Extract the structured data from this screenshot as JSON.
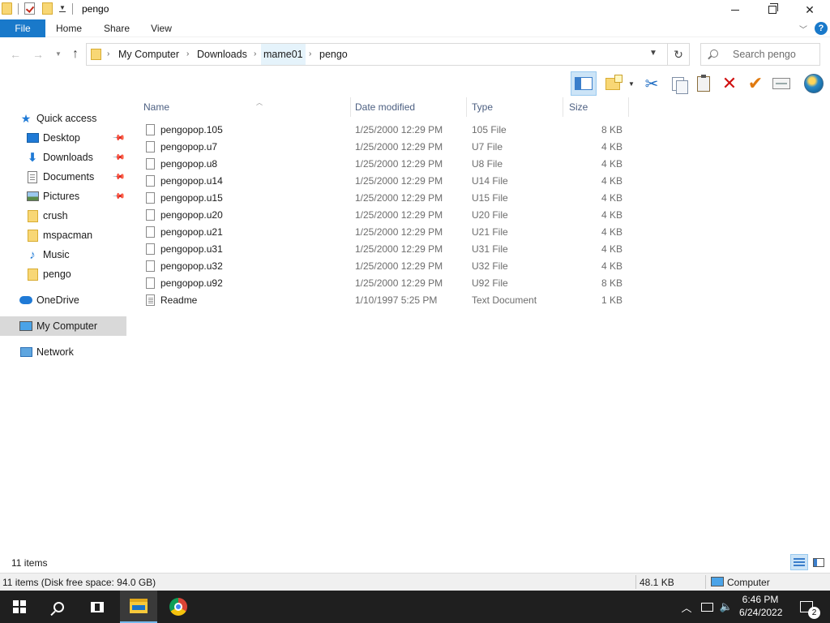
{
  "window": {
    "title": "pengo"
  },
  "ribbon": {
    "tabs": [
      "File",
      "Home",
      "Share",
      "View"
    ],
    "help_label": "?"
  },
  "address_bar": {
    "crumbs": [
      "My Computer",
      "Downloads",
      "mame01",
      "pengo"
    ]
  },
  "search": {
    "placeholder": "Search pengo"
  },
  "toolbar": {
    "buttons": [
      "preview-pane",
      "new-folder",
      "cut",
      "copy",
      "paste",
      "delete",
      "rename",
      "properties",
      "shell"
    ]
  },
  "sidebar": {
    "items": [
      {
        "label": "Quick access",
        "icon": "star-icon"
      },
      {
        "label": "Desktop",
        "icon": "desktop-icon",
        "pinned": true
      },
      {
        "label": "Downloads",
        "icon": "download-icon",
        "pinned": true
      },
      {
        "label": "Documents",
        "icon": "documents-icon",
        "pinned": true
      },
      {
        "label": "Pictures",
        "icon": "pictures-icon",
        "pinned": true
      },
      {
        "label": "crush",
        "icon": "folder-icon"
      },
      {
        "label": "mspacman",
        "icon": "folder-icon"
      },
      {
        "label": "Music",
        "icon": "music-icon"
      },
      {
        "label": "pengo",
        "icon": "folder-icon"
      },
      {
        "label": "OneDrive",
        "icon": "cloud-icon"
      },
      {
        "label": "My Computer",
        "icon": "computer-icon",
        "selected": true
      },
      {
        "label": "Network",
        "icon": "network-icon"
      }
    ]
  },
  "file_list": {
    "columns": [
      "Name",
      "Date modified",
      "Type",
      "Size"
    ],
    "rows": [
      {
        "name": "pengopop.105",
        "date": "1/25/2000 12:29 PM",
        "type": "105 File",
        "size": "8 KB"
      },
      {
        "name": "pengopop.u7",
        "date": "1/25/2000 12:29 PM",
        "type": "U7 File",
        "size": "4 KB"
      },
      {
        "name": "pengopop.u8",
        "date": "1/25/2000 12:29 PM",
        "type": "U8 File",
        "size": "4 KB"
      },
      {
        "name": "pengopop.u14",
        "date": "1/25/2000 12:29 PM",
        "type": "U14 File",
        "size": "4 KB"
      },
      {
        "name": "pengopop.u15",
        "date": "1/25/2000 12:29 PM",
        "type": "U15 File",
        "size": "4 KB"
      },
      {
        "name": "pengopop.u20",
        "date": "1/25/2000 12:29 PM",
        "type": "U20 File",
        "size": "4 KB"
      },
      {
        "name": "pengopop.u21",
        "date": "1/25/2000 12:29 PM",
        "type": "U21 File",
        "size": "4 KB"
      },
      {
        "name": "pengopop.u31",
        "date": "1/25/2000 12:29 PM",
        "type": "U31 File",
        "size": "4 KB"
      },
      {
        "name": "pengopop.u32",
        "date": "1/25/2000 12:29 PM",
        "type": "U32 File",
        "size": "4 KB"
      },
      {
        "name": "pengopop.u92",
        "date": "1/25/2000 12:29 PM",
        "type": "U92 File",
        "size": "8 KB"
      },
      {
        "name": "Readme",
        "date": "1/10/1997 5:25 PM",
        "type": "Text Document",
        "size": "1 KB"
      }
    ]
  },
  "status": {
    "item_count": "11 items",
    "disk_info": "11 items (Disk free space: 94.0 GB)",
    "total_size": "48.1 KB",
    "location": "Computer"
  },
  "taskbar": {
    "time": "6:46 PM",
    "date": "6/24/2022",
    "notifications": "2"
  },
  "colors": {
    "accent": "#1979ca",
    "selection": "#cce4f7",
    "taskbar": "#1f1f1f"
  }
}
